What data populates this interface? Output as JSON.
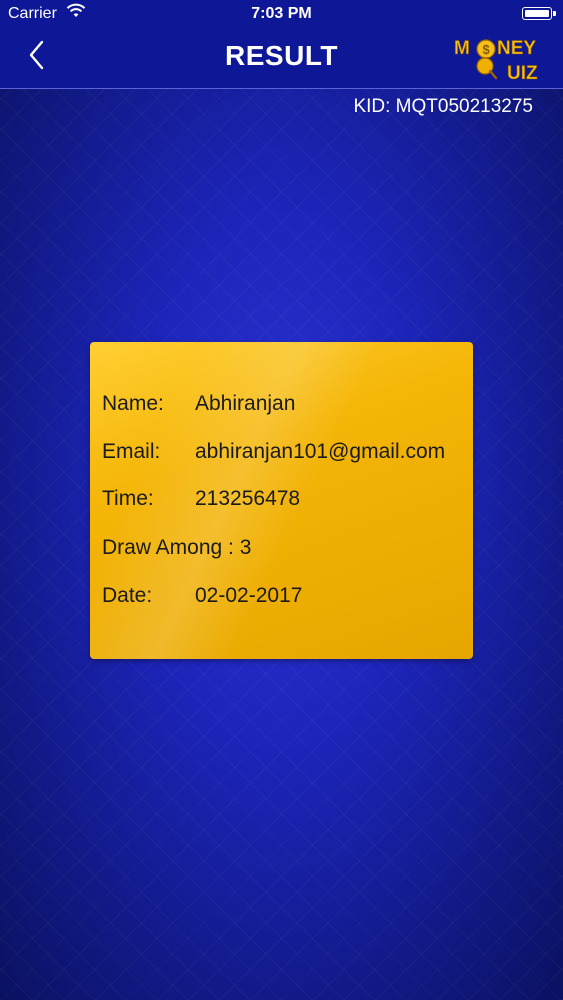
{
  "status_bar": {
    "carrier": "Carrier",
    "time": "7:03 PM"
  },
  "nav": {
    "title": "RESULT",
    "logo_line1": "MONEY",
    "logo_line2": "QUIZ"
  },
  "kid": "KID: MQT050213275",
  "card": {
    "name_label": "Name:",
    "name_value": "Abhiranjan",
    "email_label": "Email:",
    "email_value": "abhiranjan101@gmail.com",
    "time_label": "Time:",
    "time_value": "213256478",
    "draw_among": "Draw Among : 3",
    "date_label": "Date:",
    "date_value": "02-02-2017"
  },
  "colors": {
    "background": "#1c24b8",
    "nav": "#0e1796",
    "card": "#f5b608",
    "logo": "#f7c018"
  }
}
